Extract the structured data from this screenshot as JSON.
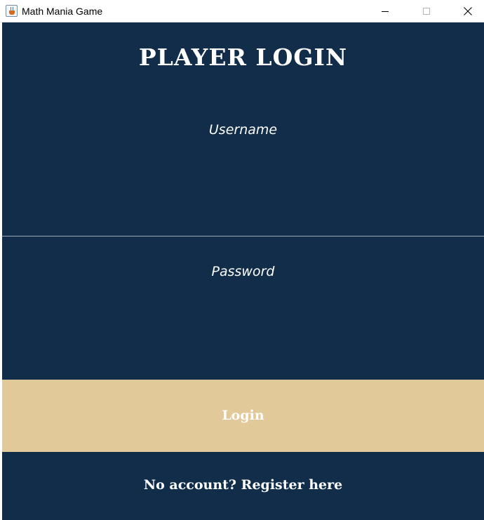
{
  "window": {
    "title": "Math Mania Game",
    "icon": "java-coffee-icon"
  },
  "colors": {
    "background": "#112d4a",
    "login_button": "#e2c999",
    "text": "#ffffff"
  },
  "login": {
    "heading": "PLAYER LOGIN",
    "username_label": "Username",
    "password_label": "Password",
    "login_button": "Login",
    "register_link": "No account? Register here"
  }
}
